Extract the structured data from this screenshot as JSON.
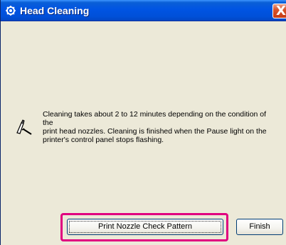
{
  "window": {
    "title": "Head Cleaning",
    "close_symbol": "X",
    "title_icon": "printer-gear-icon"
  },
  "message": {
    "icon": "note-pencil-icon",
    "lines": [
      "Cleaning takes about 2 to 12 minutes depending on the condition of the",
      "print head nozzles. Cleaning is finished when the Pause light on the",
      "printer's control panel stops flashing."
    ]
  },
  "buttons": {
    "print_nozzle_label": "Print Nozzle Check Pattern",
    "finish_label": "Finish"
  },
  "colors": {
    "titlebar": "#0054e3",
    "highlight": "#e0007f",
    "dialog_bg": "#ece9d8"
  }
}
